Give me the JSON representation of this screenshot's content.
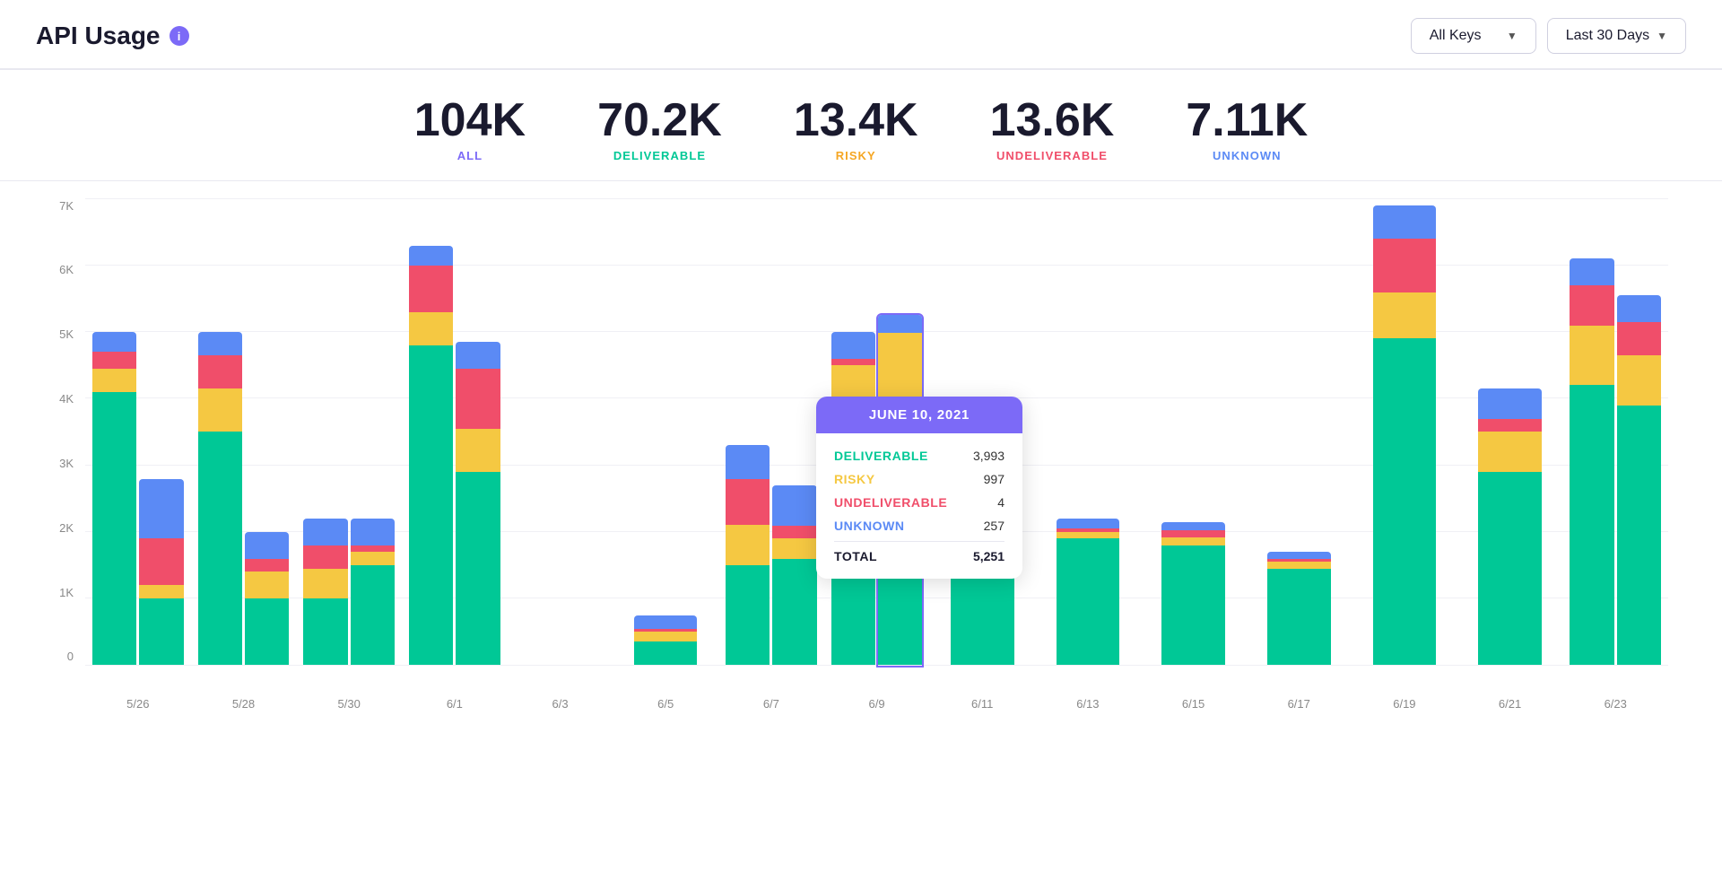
{
  "header": {
    "title": "API Usage",
    "info_icon_label": "i",
    "controls": {
      "keys_label": "All Keys",
      "days_label": "Last 30 Days"
    }
  },
  "stats": [
    {
      "value": "104K",
      "label": "ALL",
      "color_class": "label-all"
    },
    {
      "value": "70.2K",
      "label": "DELIVERABLE",
      "color_class": "label-deliverable"
    },
    {
      "value": "13.4K",
      "label": "RISKY",
      "color_class": "label-risky"
    },
    {
      "value": "13.6K",
      "label": "UNDELIVERABLE",
      "color_class": "label-undeliverable"
    },
    {
      "value": "7.11K",
      "label": "UNKNOWN",
      "color_class": "label-unknown"
    }
  ],
  "chart": {
    "y_labels": [
      "0",
      "1K",
      "2K",
      "3K",
      "4K",
      "5K",
      "6K",
      "7K"
    ],
    "x_labels": [
      "5/26",
      "5/28",
      "5/30",
      "6/1",
      "6/3",
      "6/5",
      "6/7",
      "6/9",
      "6/11",
      "6/13",
      "6/15",
      "6/17",
      "6/19",
      "6/21",
      "6/23"
    ],
    "colors": {
      "deliverable": "#00c896",
      "risky": "#f5c842",
      "undeliverable": "#f04e6a",
      "unknown": "#5b8af5"
    },
    "bars": [
      {
        "date": "5/26",
        "deliverable": 4100,
        "risky": 350,
        "undeliverable": 250,
        "unknown": 300
      },
      {
        "date": "5/26b",
        "deliverable": 1000,
        "risky": 200,
        "undeliverable": 700,
        "unknown": 900
      },
      {
        "date": "5/28",
        "deliverable": 3500,
        "risky": 650,
        "undeliverable": 500,
        "unknown": 350
      },
      {
        "date": "5/28b",
        "deliverable": 1000,
        "risky": 400,
        "undeliverable": 200,
        "unknown": 400
      },
      {
        "date": "5/30",
        "deliverable": 1000,
        "risky": 450,
        "undeliverable": 350,
        "unknown": 400
      },
      {
        "date": "5/30b",
        "deliverable": 1500,
        "risky": 200,
        "undeliverable": 100,
        "unknown": 400
      },
      {
        "date": "6/1",
        "deliverable": 4800,
        "risky": 500,
        "undeliverable": 700,
        "unknown": 300
      },
      {
        "date": "6/1b",
        "deliverable": 2900,
        "risky": 650,
        "undeliverable": 900,
        "unknown": 400
      },
      {
        "date": "6/3",
        "deliverable": 0,
        "risky": 0,
        "undeliverable": 0,
        "unknown": 0
      },
      {
        "date": "6/5",
        "deliverable": 350,
        "risky": 150,
        "undeliverable": 50,
        "unknown": 200
      },
      {
        "date": "6/7",
        "deliverable": 1500,
        "risky": 600,
        "undeliverable": 700,
        "unknown": 500
      },
      {
        "date": "6/7b",
        "deliverable": 1600,
        "risky": 300,
        "undeliverable": 200,
        "unknown": 600
      },
      {
        "date": "6/9",
        "deliverable": 3800,
        "risky": 700,
        "undeliverable": 100,
        "unknown": 400
      },
      {
        "date": "6/9b",
        "deliverable": 3900,
        "risky": 650,
        "undeliverable": 200,
        "unknown": 350
      },
      {
        "date": "6/11",
        "deliverable": 1950,
        "risky": 150,
        "undeliverable": 100,
        "unknown": 200
      },
      {
        "date": "6/13",
        "deliverable": 1900,
        "risky": 100,
        "undeliverable": 50,
        "unknown": 150
      },
      {
        "date": "6/15",
        "deliverable": 1800,
        "risky": 120,
        "undeliverable": 100,
        "unknown": 130
      },
      {
        "date": "6/17",
        "deliverable": 1450,
        "risky": 100,
        "undeliverable": 50,
        "unknown": 100
      },
      {
        "date": "6/19",
        "deliverable": 4900,
        "risky": 700,
        "undeliverable": 800,
        "unknown": 500
      },
      {
        "date": "6/21",
        "deliverable": 2900,
        "risky": 600,
        "undeliverable": 200,
        "unknown": 450
      },
      {
        "date": "6/23a",
        "deliverable": 4200,
        "risky": 900,
        "undeliverable": 600,
        "unknown": 400
      },
      {
        "date": "6/23b",
        "deliverable": 3900,
        "risky": 750,
        "undeliverable": 500,
        "unknown": 400
      }
    ]
  },
  "tooltip": {
    "date": "JUNE 10, 2021",
    "rows": [
      {
        "label": "DELIVERABLE",
        "value": "3,993",
        "color": "#00c896"
      },
      {
        "label": "RISKY",
        "value": "997",
        "color": "#f5c842"
      },
      {
        "label": "UNDELIVERABLE",
        "value": "4",
        "color": "#f04e6a"
      },
      {
        "label": "UNKNOWN",
        "value": "257",
        "color": "#5b8af5"
      }
    ],
    "total_label": "TOTAL",
    "total_value": "5,251"
  }
}
